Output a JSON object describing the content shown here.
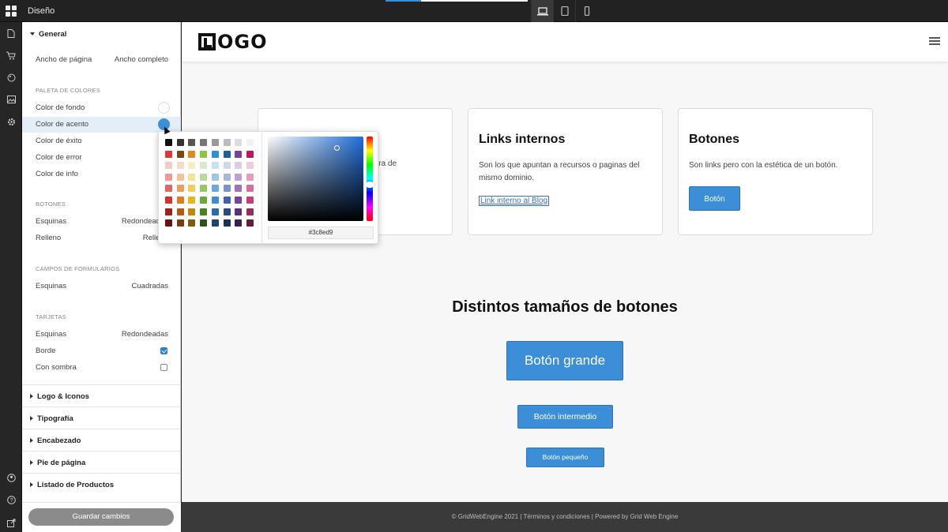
{
  "app": {
    "title": "Diseño"
  },
  "panel": {
    "general_title": "General",
    "page_width": {
      "label": "Ancho de página",
      "value": "Ancho completo"
    },
    "palette_title": "PALETA DE COLORES",
    "palette": [
      {
        "label": "Color de fondo",
        "color": "#ffffff"
      },
      {
        "label": "Color de acento",
        "color": "#3c8ed9"
      },
      {
        "label": "Color de éxito"
      },
      {
        "label": "Color de error"
      },
      {
        "label": "Color de info"
      }
    ],
    "buttons_title": "BOTONES",
    "buttons": [
      {
        "label": "Esquinas",
        "value": "Redondeadas"
      },
      {
        "label": "Relleno",
        "value": "Relleno"
      }
    ],
    "forms_title": "CAMPOS DE FORMULARIOS",
    "forms": [
      {
        "label": "Esquinas",
        "value": "Cuadradas"
      }
    ],
    "cards_title": "TARJETAS",
    "cards": {
      "corners_label": "Esquinas",
      "corners_value": "Redondeadas",
      "border_label": "Borde",
      "border_checked": true,
      "shadow_label": "Con sombra",
      "shadow_checked": false
    },
    "accordions": [
      "Logo & Iconos",
      "Tipografía",
      "Encabezado",
      "Pie de página",
      "Listado de Productos"
    ],
    "save_label": "Guardar cambios"
  },
  "picker": {
    "hex": "#3c8ed9",
    "swatches": [
      [
        "#111111",
        "#333333",
        "#555555",
        "#777777",
        "#999999",
        "#bbbbbb",
        "#dddddd",
        "#f2f2f2"
      ],
      [
        "#e0363a",
        "#7a4a12",
        "#e08a1e",
        "#8dc63f",
        "#2e8fd8",
        "#1f5e9c",
        "#7b3fa0",
        "#c2185b"
      ],
      [
        "#f6c9c6",
        "#f3dcc6",
        "#f7efc4",
        "#dbe9c9",
        "#cbe0ee",
        "#cfd8ea",
        "#dccce6",
        "#efcbdb"
      ],
      [
        "#ef9a97",
        "#f2c298",
        "#f5e292",
        "#bcd99c",
        "#9ec7e4",
        "#a8b8dc",
        "#bd9fd3",
        "#e39ebb"
      ],
      [
        "#e06661",
        "#ec9e5e",
        "#f1cf5a",
        "#96c565",
        "#6aa9da",
        "#7b93c8",
        "#9c72bd",
        "#d56f99"
      ],
      [
        "#d1342e",
        "#e07a25",
        "#e8b51f",
        "#6aa83b",
        "#3c8ed9",
        "#3f64ad",
        "#7643a3",
        "#c43d74"
      ],
      [
        "#a01f1b",
        "#b35a12",
        "#bb8b11",
        "#4a7f27",
        "#2a6aa8",
        "#2a4985",
        "#57307e",
        "#962c57"
      ],
      [
        "#6b1210",
        "#7a3c0c",
        "#7d5d0a",
        "#2f5419",
        "#1b476f",
        "#1b3058",
        "#3a1f54",
        "#641c3a"
      ]
    ]
  },
  "site": {
    "logo": "OGO",
    "cards": [
      {
        "title": "",
        "text": "a fuera de"
      },
      {
        "title": "Links internos",
        "text": "Son los que apuntan a recursos o paginas del mismo dominio.",
        "link": "Link interno al Blog"
      },
      {
        "title": "Botones",
        "text": "Son links pero con la estética de un botón.",
        "button": "Botón"
      }
    ],
    "sizes_title": "Distintos tamaños de botones",
    "btn_large": "Botón grande",
    "btn_medium": "Botón intermedio",
    "btn_small": "Botón pequeño",
    "footer": "© GridWebEngine 2021 | Términos y condiciones | Powered by Grid Web Engine"
  },
  "colors": {
    "accent": "#3c8ed9",
    "dark_bg": "#2b2b2b"
  }
}
